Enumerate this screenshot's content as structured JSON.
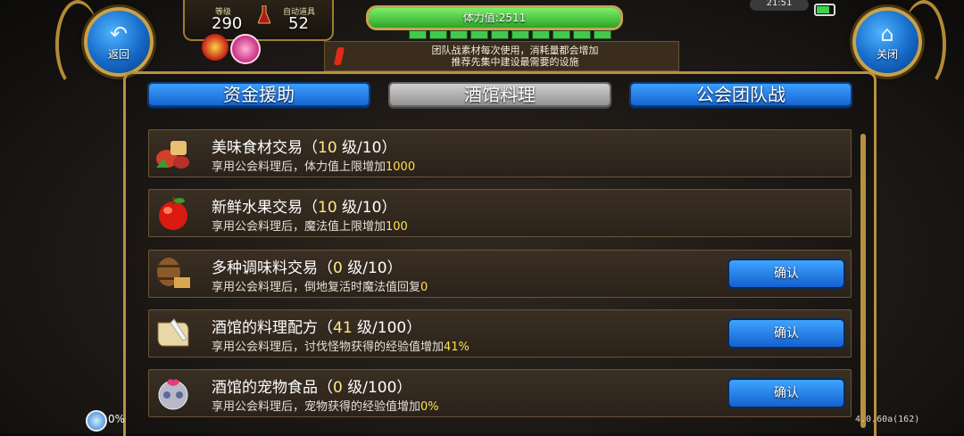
{
  "nav": {
    "back_label": "返回",
    "close_label": "关闭"
  },
  "stats": {
    "level_label": "等级",
    "level_value": "290",
    "auto_label": "自动道具",
    "auto_value": "52"
  },
  "hp": {
    "text": "体力值:2511",
    "fill_fraction": 1.0
  },
  "notice": {
    "line1": "团队战素材每次使用，消耗量都会增加",
    "line2": "推荐先集中建设最需要的设施"
  },
  "status_bar": {
    "clock": "21:51"
  },
  "tabs": [
    {
      "label": "资金援助",
      "selected": false
    },
    {
      "label": "酒馆料理",
      "selected": true
    },
    {
      "label": "公会团队战",
      "selected": false
    }
  ],
  "rows": [
    {
      "icon": "food-icon",
      "name": "美味食材交易（",
      "level": "10",
      "level_tail": " 级/10）",
      "desc": "享用公会料理后，体力值上限增加",
      "value": "1000",
      "button": ""
    },
    {
      "icon": "apple-icon",
      "name": "新鲜水果交易（",
      "level": "10",
      "level_tail": " 级/10）",
      "desc": "享用公会料理后，魔法值上限增加",
      "value": "100",
      "button": ""
    },
    {
      "icon": "barrel-icon",
      "name": "多种调味料交易（",
      "level": "0",
      "level_tail": " 级/10）",
      "desc": "享用公会料理后，倒地复活时魔法值回复",
      "value": "0",
      "button": "确认"
    },
    {
      "icon": "recipe-scroll-icon",
      "name": "酒馆的料理配方（",
      "level": "41",
      "level_tail": " 级/100）",
      "desc": "享用公会料理后，讨伐怪物获得的经验值增加",
      "value": "41%",
      "button": "确认"
    },
    {
      "icon": "pet-food-icon",
      "name": "酒馆的宠物食品（",
      "level": "0",
      "level_tail": " 级/100）",
      "desc": "享用公会料理后，宠物获得的经验值增加",
      "value": "0%",
      "button": "确认"
    }
  ],
  "footer": {
    "percent": "0%",
    "version": "4.0.60a(162)"
  },
  "colors": {
    "accent_blue": "#1e7ae8",
    "gold": "#b79140",
    "highlight": "#ffe14d"
  }
}
